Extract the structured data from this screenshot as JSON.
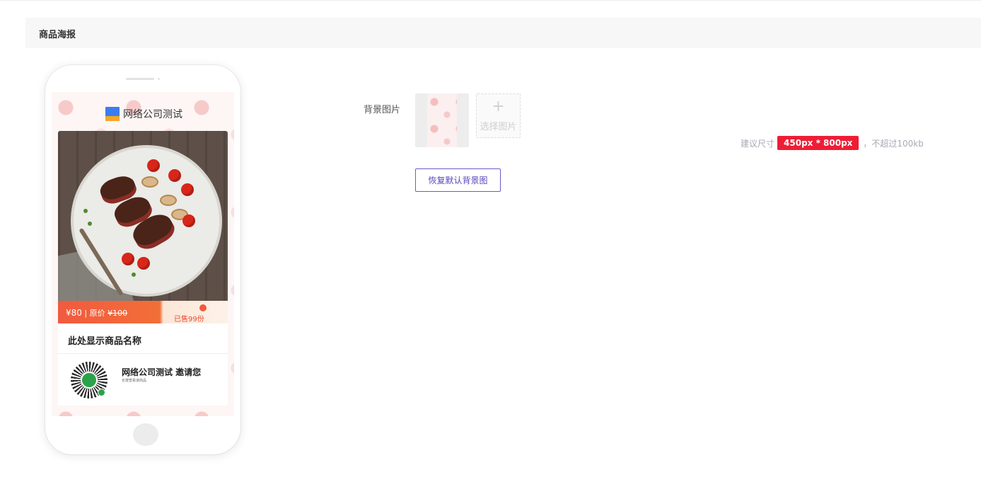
{
  "header": {
    "title": "商品海报"
  },
  "poster": {
    "brand_name": "网络公司测试",
    "price": "¥80",
    "original_price_label": "| 原价",
    "original_price": "¥100",
    "sold_text": "已售99份",
    "product_name": "此处显示商品名称",
    "invite_title": "网络公司测试 邀请您",
    "invite_subtitle": "长按查看该商品"
  },
  "form": {
    "background_label": "背景图片",
    "picker_plus": "+",
    "picker_label": "选择图片",
    "hint_prefix": "建议尺寸",
    "hint_size": "450px * 800px",
    "hint_suffix": "，不超过100kb",
    "reset_button": "恢复默认背景图"
  },
  "colors": {
    "accent": "#6f58c9",
    "badge_red": "#ee1d35",
    "price_orange": "#f15a3f"
  }
}
